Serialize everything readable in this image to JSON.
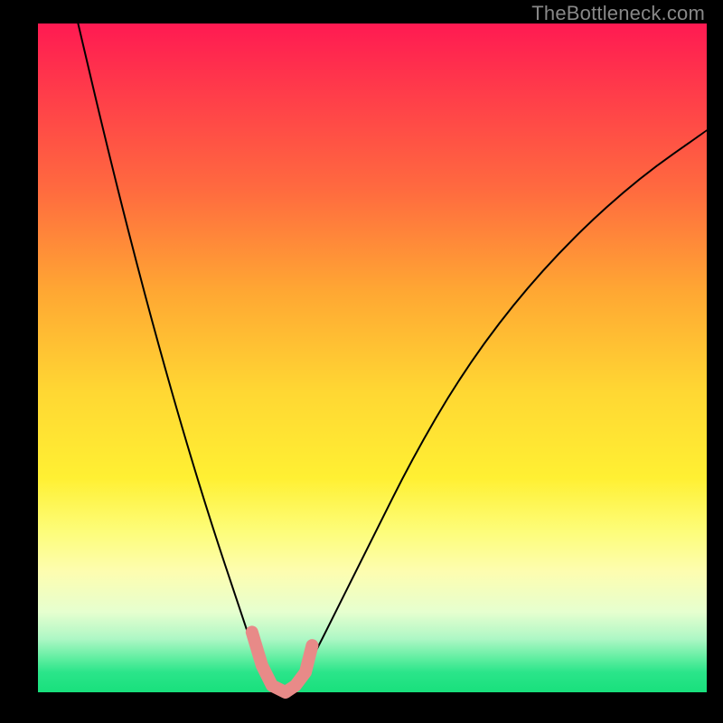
{
  "watermark": "TheBottleneck.com",
  "chart_data": {
    "type": "line",
    "title": "",
    "xlabel": "",
    "ylabel": "",
    "xlim": [
      0,
      100
    ],
    "ylim": [
      0,
      100
    ],
    "grid": false,
    "notes": "Bottleneck-style plot: vertical gradient background (red top → green bottom) represents badness. Two black curves descend into a shared minimum near x≈35 then diverge. A short salmon segment highlights the valley floor.",
    "series": [
      {
        "name": "left-curve",
        "x": [
          6,
          10,
          14,
          18,
          22,
          26,
          30,
          33,
          35
        ],
        "y": [
          100,
          83,
          67,
          52,
          38,
          25,
          13,
          4,
          0
        ]
      },
      {
        "name": "right-curve",
        "x": [
          38,
          41,
          45,
          50,
          56,
          63,
          71,
          80,
          90,
          100
        ],
        "y": [
          0,
          5,
          13,
          23,
          35,
          47,
          58,
          68,
          77,
          84
        ]
      },
      {
        "name": "valley-marker",
        "color": "#e88a88",
        "x": [
          32,
          33.5,
          35,
          37,
          38.5,
          40,
          41
        ],
        "y": [
          9,
          4,
          1,
          0,
          1,
          3,
          7
        ]
      }
    ]
  }
}
